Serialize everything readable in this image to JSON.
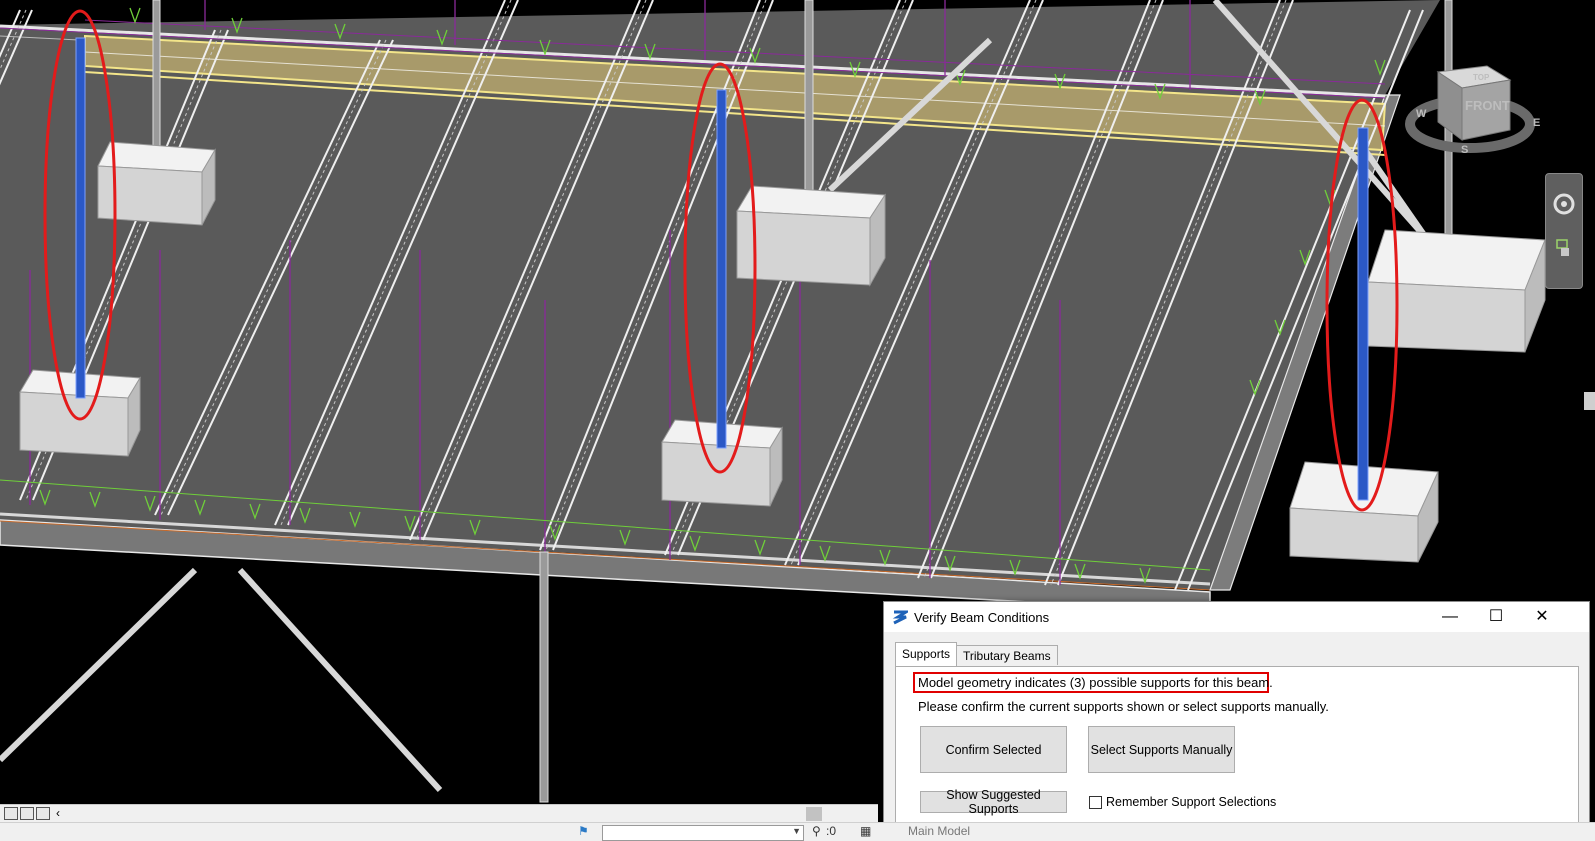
{
  "viewcube": {
    "face_label": "FRONT",
    "top_label": "TOP",
    "compass": {
      "west": "W",
      "east": "E",
      "south": "S"
    }
  },
  "colors": {
    "background": "#000000",
    "slab": "#5a5a5a",
    "highlighted_beam": "#a89a6a",
    "column_selected": "#2b58c6",
    "annotation_red": "#e31b1b",
    "load_arrow": "#6fcf3a",
    "grid_line": "#8a2a9a"
  },
  "view_bar": {
    "icons": [
      "viewport-icon",
      "view-cube-icon",
      "crop-icon",
      "chevron-left-icon"
    ]
  },
  "status_bar": {
    "coordinate": ":0",
    "model_name": "Main Model"
  },
  "dialog": {
    "title": "Verify Beam Conditions",
    "tabs": [
      {
        "label": "Supports",
        "active": true
      },
      {
        "label": "Tributary Beams",
        "active": false
      }
    ],
    "message_primary": "Model geometry indicates (3) possible supports for this beam.",
    "message_secondary": "Please confirm the current supports shown or select supports manually.",
    "buttons": {
      "confirm": "Confirm Selected",
      "manual": "Select Supports Manually",
      "suggested": "Show Suggested Supports"
    },
    "remember_checkbox": {
      "label": "Remember Support Selections",
      "checked": false
    },
    "window_controls": {
      "minimize": "—",
      "maximize": "☐",
      "close": "✕"
    }
  }
}
